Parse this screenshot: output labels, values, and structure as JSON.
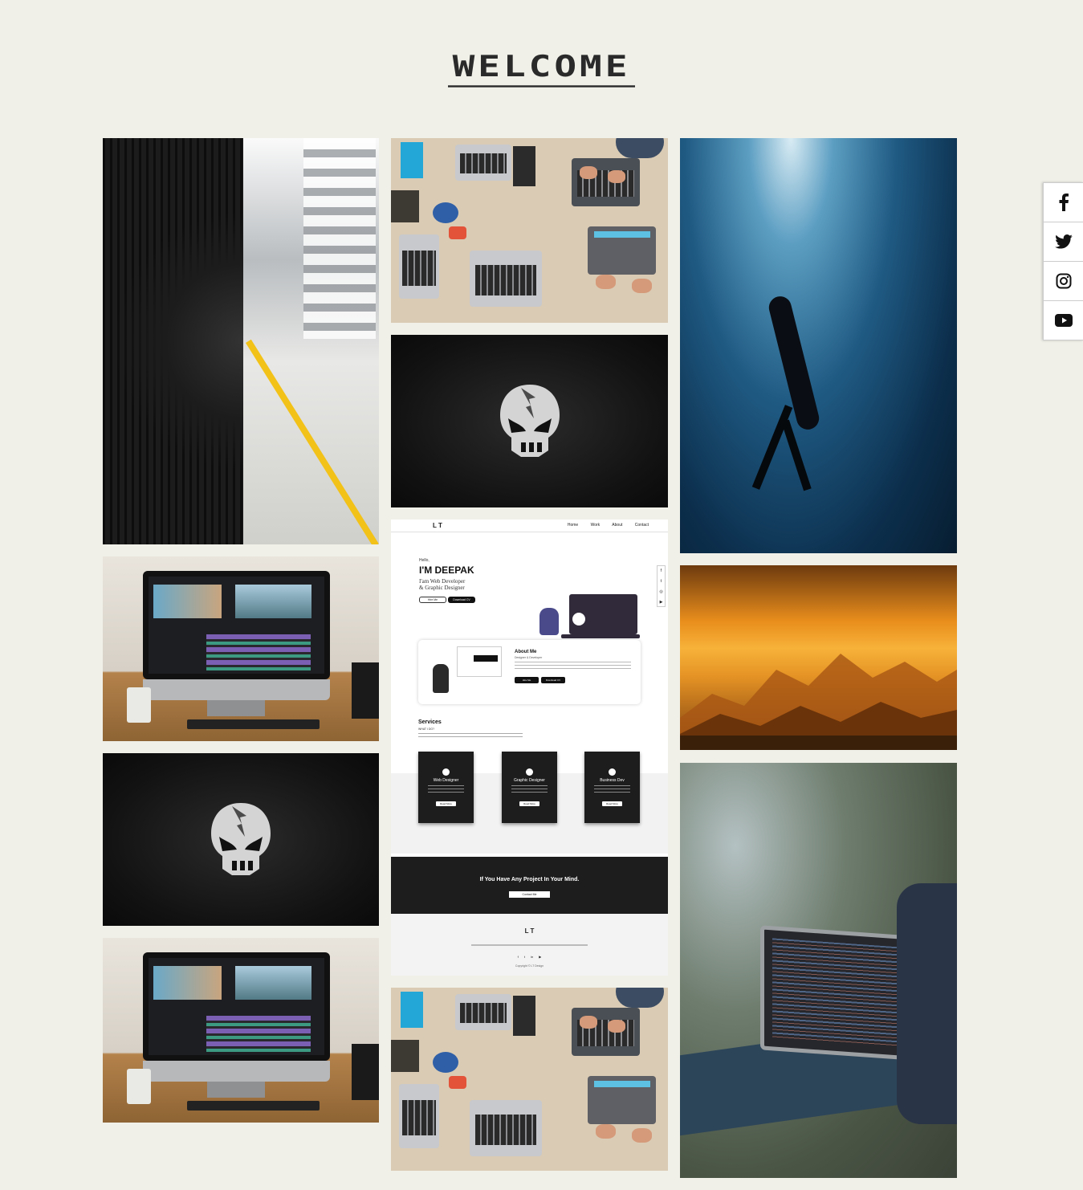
{
  "header": {
    "title": "WELCOME"
  },
  "gallery": {
    "tiles": [
      {
        "id": "subway-tunnel",
        "label": "Subway tunnel photo"
      },
      {
        "id": "desk-workspace-1",
        "label": "Desk workspace photo"
      },
      {
        "id": "diver",
        "label": "Freediver photo"
      }
    ]
  },
  "mockup": {
    "logo": "L T",
    "nav": [
      "Home",
      "Work",
      "About",
      "Contact"
    ],
    "hello": "Hello,",
    "name": "I'M DEEPAK",
    "role1": "I'am Web Developer",
    "role2": "& Graphic Designer",
    "hire_btn": "Hire Me",
    "cv_btn": "Download CV",
    "about_title": "About Me",
    "about_sub": "Designer & Developer",
    "about_b1": "Hire Me",
    "about_b2": "Download CV",
    "services_title": "Services",
    "services_sub": "WHAT I DO?",
    "cards": [
      {
        "title": "Web Designer",
        "btn": "Read More"
      },
      {
        "title": "Graphic Designer",
        "btn": "Read More"
      },
      {
        "title": "Business Dev",
        "btn": "Read More"
      }
    ],
    "cta_text": "If You Have Any Project In Your Mind.",
    "cta_btn": "Contact Me",
    "footer_logo": "L T",
    "footer_icons": "f t in ▶",
    "copyright": "Copyright © LT Design"
  },
  "social": [
    {
      "name": "facebook",
      "icon": "facebook-icon"
    },
    {
      "name": "twitter",
      "icon": "twitter-icon"
    },
    {
      "name": "instagram",
      "icon": "instagram-icon"
    },
    {
      "name": "youtube",
      "icon": "youtube-icon"
    }
  ]
}
